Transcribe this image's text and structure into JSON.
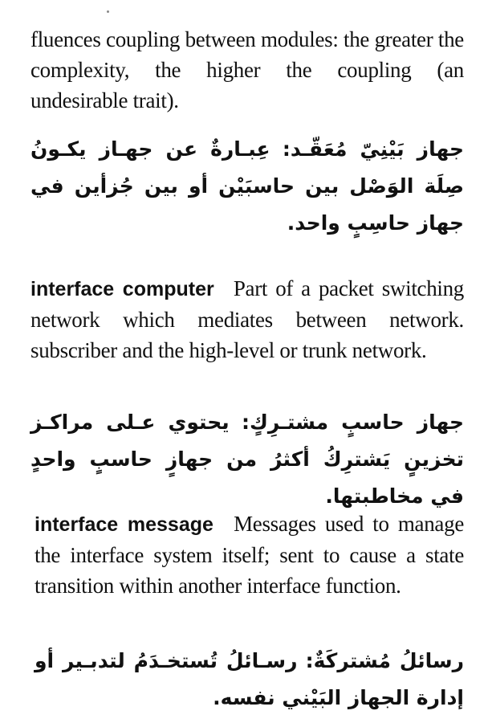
{
  "continuation": {
    "english": "fluences coupling between modules: the greater the complexity, the higher the coupling (an undesirable trait).",
    "arabic_term": "جهاز بَيْنِيّ مُعَقّـد:",
    "arabic_definition": "عِبـارةٌ عن جهـاز يكـونُ صِلَة الوَصْل بين حاسبَيْن أو بين جُزأين في جهاز حاسِبٍ واحد."
  },
  "entries": [
    {
      "term": "interface computer",
      "definition": "Part of a packet switching network which mediates between network. subscriber and the high-level or trunk network.",
      "arabic_term": "جهاز حاسبٍ مشتـرِكٍ:",
      "arabic_definition": "يحتوي عـلى مراكـز تخزينٍ يَشترِكُ أكثرُ من جهازٍ حاسبٍ واحدٍ في مخاطبتها."
    },
    {
      "term": "interface message",
      "definition": "Messages used to manage the interface system itself; sent to cause a state transition within another interface function.",
      "arabic_term": "رسائلُ مُشتركَةٌ:",
      "arabic_definition": "رسـائلُ تُستخـدَمُ لتدبـير أو إدارة الجهاز البَيْني نفسه."
    }
  ]
}
